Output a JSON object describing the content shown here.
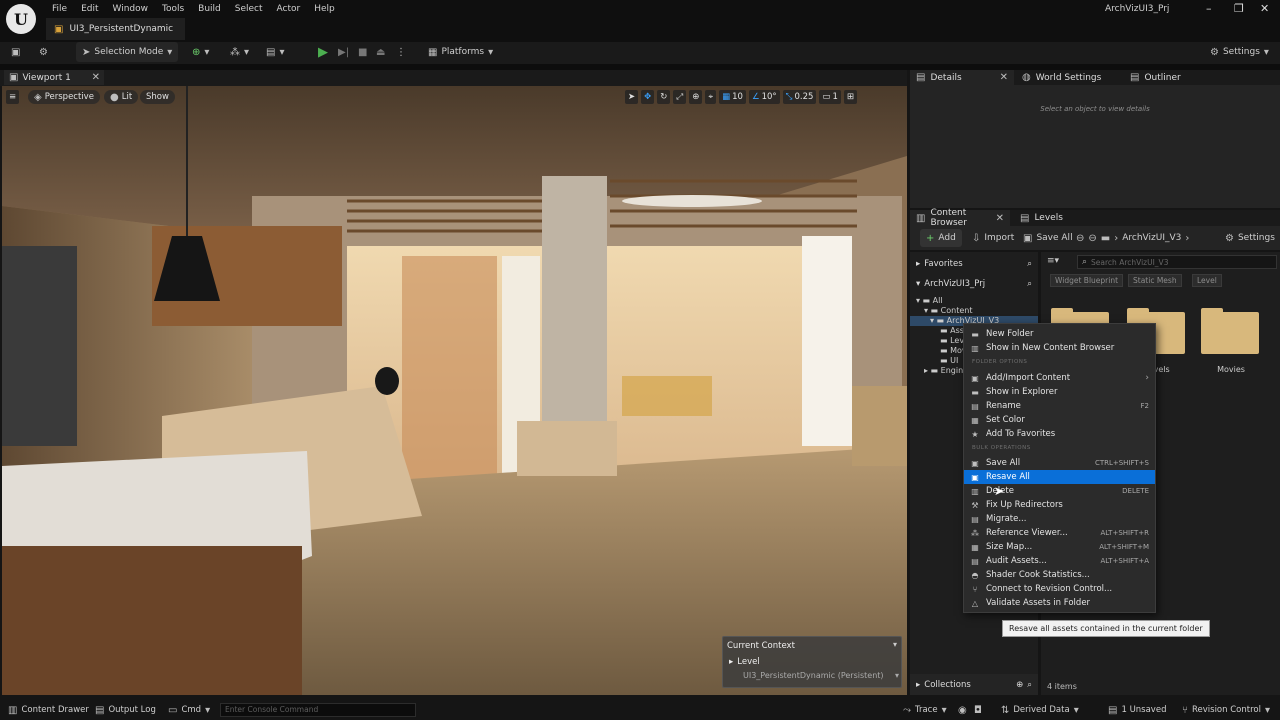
{
  "menubar": {
    "items": [
      "File",
      "Edit",
      "Window",
      "Tools",
      "Build",
      "Select",
      "Actor",
      "Help"
    ],
    "level_tab": "UI3_PersistentDynamic",
    "project_name": "ArchVizUI3_Prj"
  },
  "toolbar": {
    "selection_mode": "Selection Mode",
    "platforms": "Platforms",
    "settings": "Settings"
  },
  "viewport": {
    "tab_label": "Viewport 1",
    "perspective": "Perspective",
    "lit": "Lit",
    "show": "Show",
    "grid_snap": "10",
    "rotation_snap": "10°",
    "scale_snap": "0.25",
    "camera_speed": "1"
  },
  "current_context": {
    "title": "Current Context",
    "level_label": "Level",
    "level_value": "UI3_PersistentDynamic (Persistent)"
  },
  "details": {
    "tabs": [
      "Details",
      "World Settings",
      "Outliner"
    ],
    "hint": "Select an object to view details"
  },
  "content_browser": {
    "tabs": [
      "Content Browser",
      "Levels"
    ],
    "add": "Add",
    "import": "Import",
    "save_all": "Save All",
    "path": "ArchVizUI_V3",
    "settings": "Settings",
    "favorites": "Favorites",
    "project": "ArchVizUI3_Prj",
    "search_placeholder": "Search ArchVizUI_V3",
    "filters": [
      "Widget Blueprint",
      "Static Mesh",
      "Level"
    ],
    "tree": [
      "All",
      "Content",
      "ArchVizUI_V3",
      "Assets",
      "Levels",
      "Movies",
      "UI",
      "Engine"
    ],
    "folder_labels": [
      "Levels",
      "Movies"
    ],
    "collections": "Collections",
    "item_count": "4 items"
  },
  "context_menu": {
    "items": [
      {
        "label": "New Folder",
        "shortcut": "",
        "icon": "folder-icon"
      },
      {
        "label": "Show in New Content Browser",
        "shortcut": "",
        "icon": "browser-icon"
      },
      {
        "label": "Add/Import Content",
        "shortcut": "",
        "icon": "import-icon"
      },
      {
        "label": "Show in Explorer",
        "shortcut": "",
        "icon": "explorer-icon"
      },
      {
        "label": "Rename",
        "shortcut": "F2",
        "icon": "rename-icon"
      },
      {
        "label": "Set Color",
        "shortcut": "",
        "icon": "color-icon"
      },
      {
        "label": "Add To Favorites",
        "shortcut": "",
        "icon": "star-icon"
      },
      {
        "label": "Save All",
        "shortcut": "CTRL+SHIFT+S",
        "icon": "save-icon"
      },
      {
        "label": "Resave All",
        "shortcut": "",
        "icon": "resave-icon"
      },
      {
        "label": "Delete",
        "shortcut": "DELETE",
        "icon": "delete-icon"
      },
      {
        "label": "Fix Up Redirectors",
        "shortcut": "",
        "icon": "wrench-icon"
      },
      {
        "label": "Migrate...",
        "shortcut": "",
        "icon": "migrate-icon"
      },
      {
        "label": "Reference Viewer...",
        "shortcut": "ALT+SHIFT+R",
        "icon": "reference-icon"
      },
      {
        "label": "Size Map...",
        "shortcut": "ALT+SHIFT+M",
        "icon": "sizemap-icon"
      },
      {
        "label": "Audit Assets...",
        "shortcut": "ALT+SHIFT+A",
        "icon": "audit-icon"
      },
      {
        "label": "Shader Cook Statistics...",
        "shortcut": "",
        "icon": "shader-icon"
      },
      {
        "label": "Connect to Revision Control...",
        "shortcut": "",
        "icon": "revision-icon"
      },
      {
        "label": "Validate Assets in Folder",
        "shortcut": "",
        "icon": "validate-icon"
      }
    ],
    "section_folder": "FOLDER OPTIONS",
    "section_bulk": "BULK OPERATIONS"
  },
  "tooltip": "Resave all assets contained in the current folder",
  "statusbar": {
    "content_drawer": "Content Drawer",
    "output_log": "Output Log",
    "cmd": "Cmd",
    "console_placeholder": "Enter Console Command",
    "trace": "Trace",
    "derived_data": "Derived Data",
    "unsaved": "1 Unsaved",
    "revision_control": "Revision Control"
  },
  "colors": {
    "accent": "#0a6fd8",
    "play": "#4caf50",
    "folder": "#d8b87c"
  }
}
